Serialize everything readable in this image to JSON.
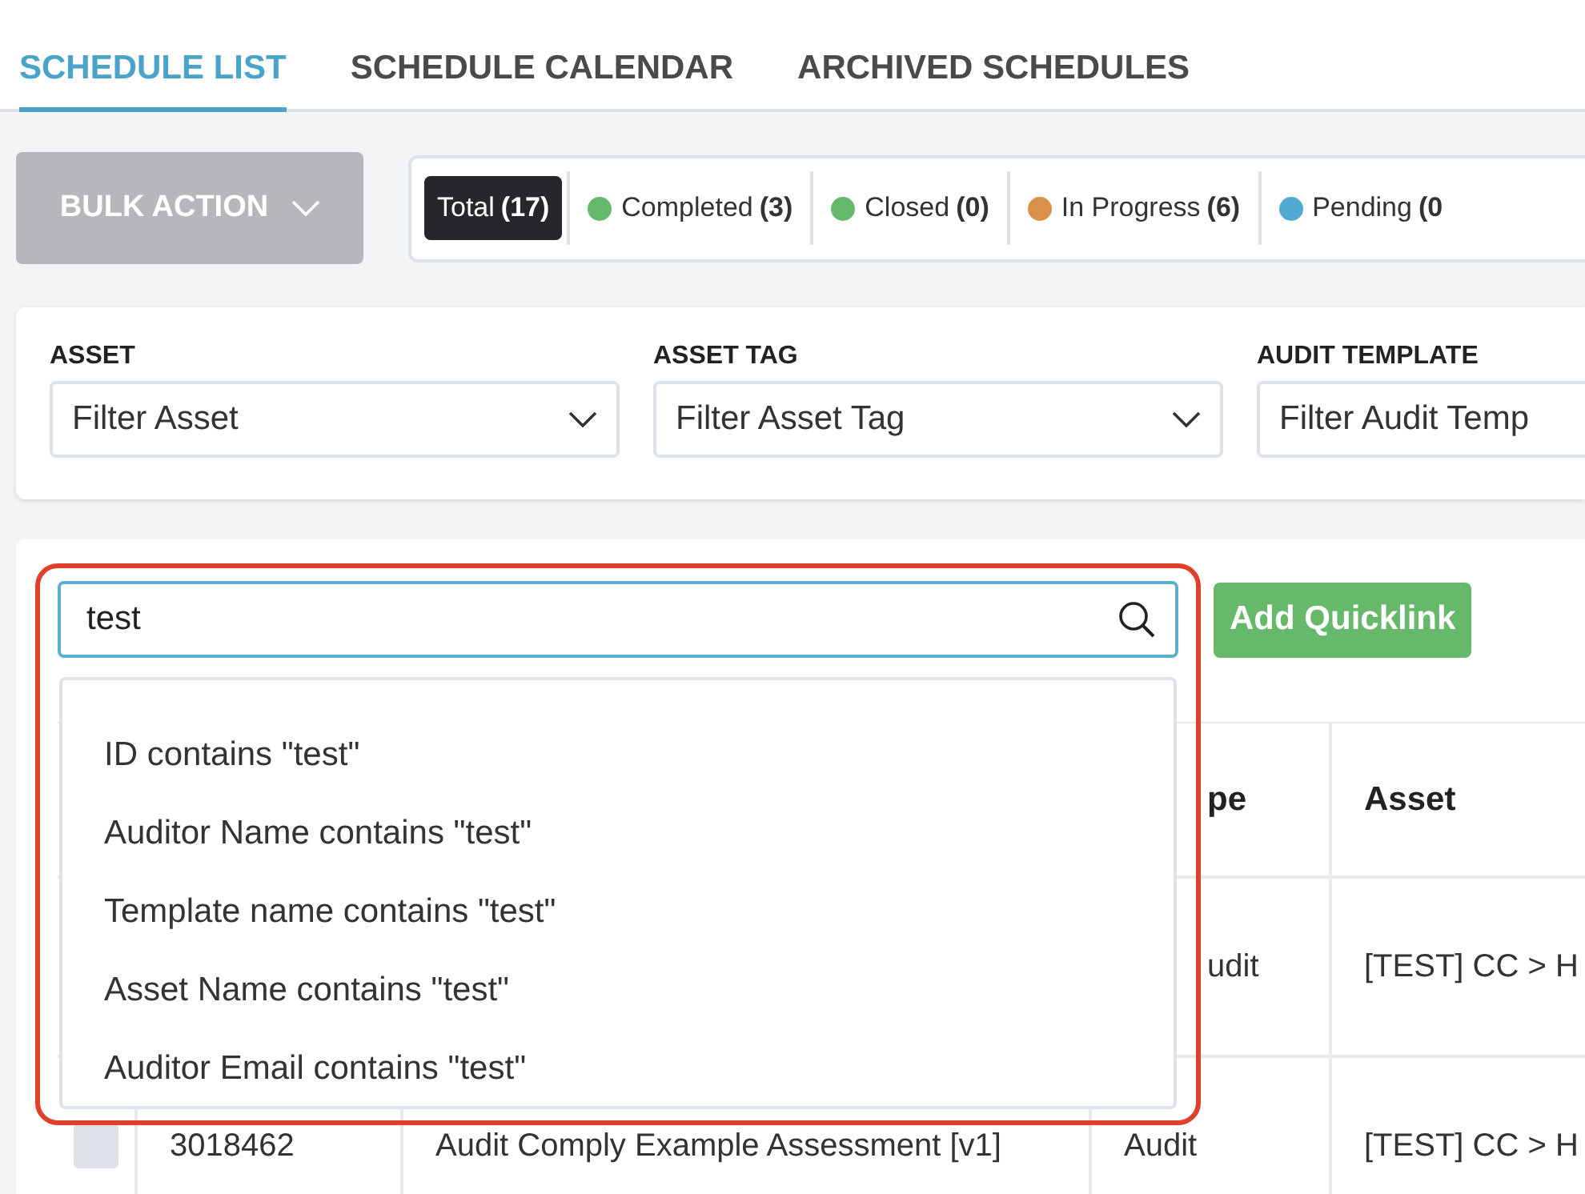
{
  "tabs": [
    {
      "label": "SCHEDULE LIST",
      "selected": true
    },
    {
      "label": "SCHEDULE CALENDAR",
      "selected": false
    },
    {
      "label": "ARCHIVED SCHEDULES",
      "selected": false
    }
  ],
  "bulk_action": {
    "label": "BULK ACTION"
  },
  "status_filters": [
    {
      "label": "Total",
      "count": "(17)",
      "selected": true
    },
    {
      "label": "Completed",
      "count": "(3)",
      "color": "#66b96a",
      "selected": false
    },
    {
      "label": "Closed",
      "count": "(0)",
      "color": "#66b96a",
      "selected": false
    },
    {
      "label": "In Progress",
      "count": "(6)",
      "color": "#d9914a",
      "selected": false
    },
    {
      "label": "Pending",
      "count": "(0",
      "color": "#52a9d1",
      "selected": false
    }
  ],
  "filters": [
    {
      "label": "ASSET",
      "placeholder": "Filter Asset"
    },
    {
      "label": "ASSET TAG",
      "placeholder": "Filter Asset Tag"
    },
    {
      "label": "AUDIT TEMPLATE",
      "placeholder": "Filter Audit Temp"
    }
  ],
  "search": {
    "value": "test"
  },
  "add_quicklink": {
    "label": "Add Quicklink"
  },
  "suggestions": [
    "ID contains \"test\"",
    "Auditor Name contains \"test\"",
    "Template name contains \"test\"",
    "Asset Name contains \"test\"",
    "Auditor Email contains \"test\""
  ],
  "table": {
    "columns": [
      {
        "label": "pe"
      },
      {
        "label": "Asset"
      }
    ],
    "rows": [
      {
        "type": "udit",
        "asset": "[TEST] CC > H"
      },
      {
        "checked": false,
        "id": "3018462",
        "template": "Audit Comply Example Assessment [v1]",
        "type": "Audit",
        "asset": "[TEST] CC > H"
      }
    ]
  }
}
